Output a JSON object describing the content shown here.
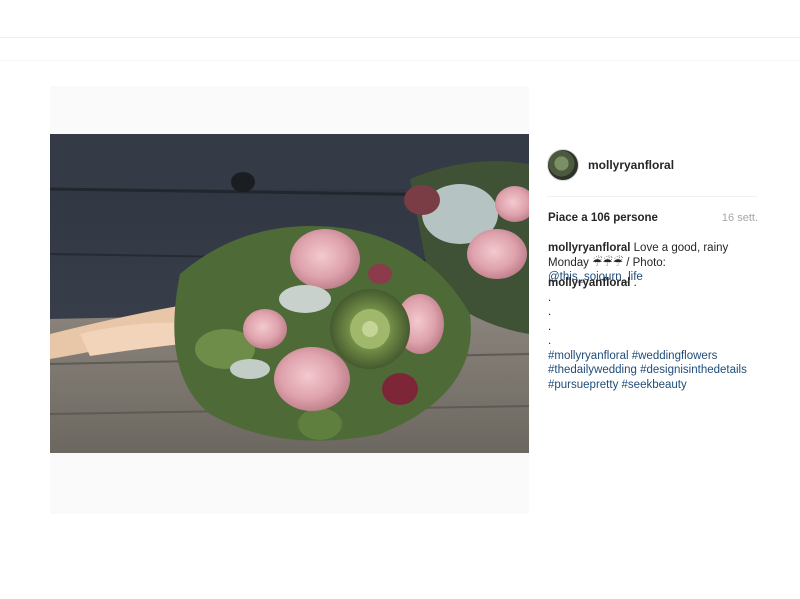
{
  "post": {
    "username": "mollyryanfloral",
    "likes": "Piace a 106 persone",
    "time": "16 sett.",
    "caption": {
      "user": "mollyryanfloral",
      "text_before_link": " Love a good, rainy Monday ☔☔☔ / Photo: ",
      "link": "@this_sojourn_life"
    },
    "comment": {
      "user": "mollyryanfloral",
      "first_line_rest": " .",
      "dots": [
        ".",
        ".",
        ".",
        "."
      ],
      "hashtags": [
        [
          "#mollyryanfloral",
          "#weddingflowers"
        ],
        [
          "#thedailywedding",
          "#designisinthedetails"
        ],
        [
          "#pursuepretty",
          "#seekbeauty"
        ]
      ]
    }
  },
  "icons": {
    "avatar": "profile-avatar-icon"
  }
}
